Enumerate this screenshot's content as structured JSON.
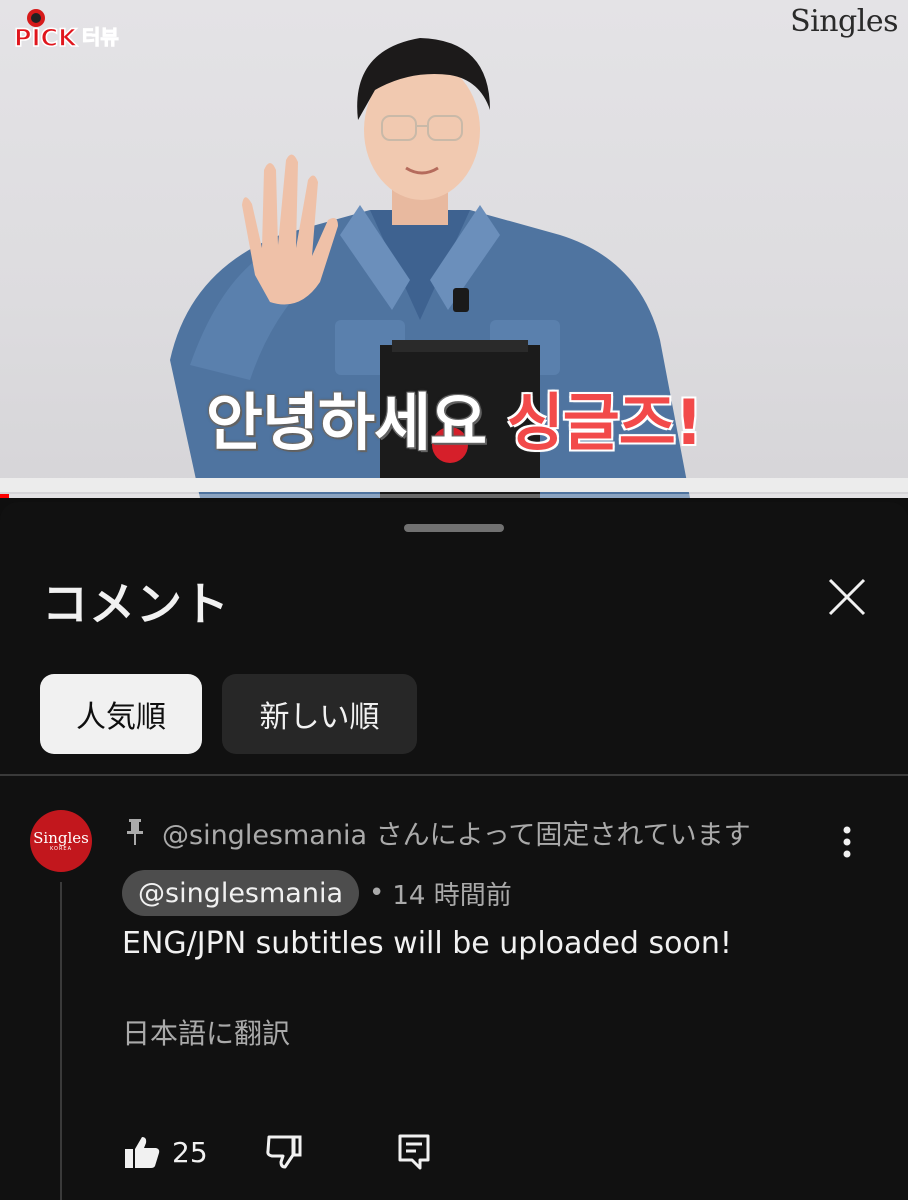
{
  "video": {
    "logo_left": "PICK 터뷰",
    "logo_right": "Singles",
    "subtitle_white": "안녕하세요",
    "subtitle_red": "싱글즈!",
    "progress": 0.01
  },
  "comments_panel": {
    "title": "コメント",
    "sort_chips": [
      {
        "label": "人気順",
        "active": true
      },
      {
        "label": "新しい順",
        "active": false
      }
    ],
    "pinned_comment": {
      "avatar_text": "Singles",
      "avatar_subtext": "KOREA",
      "pinned_label": "@singlesmania さんによって固定されています",
      "author": "@singlesmania",
      "separator": "•",
      "time": "14 時間前",
      "text": "ENG/JPN subtitles will be uploaded soon!",
      "translate_label": "日本語に翻訳",
      "like_count": "25"
    }
  },
  "colors": {
    "background": "#0f0f0f",
    "sheet": "#111111",
    "active_chip": "#f1f1f1",
    "idle_chip": "#272727",
    "avatar": "#c2171d",
    "subtitle_red": "#f24a4a"
  },
  "icons": [
    "pin-icon",
    "close-icon",
    "more-vert-icon",
    "thumb-up-icon",
    "thumb-down-icon",
    "reply-icon"
  ]
}
